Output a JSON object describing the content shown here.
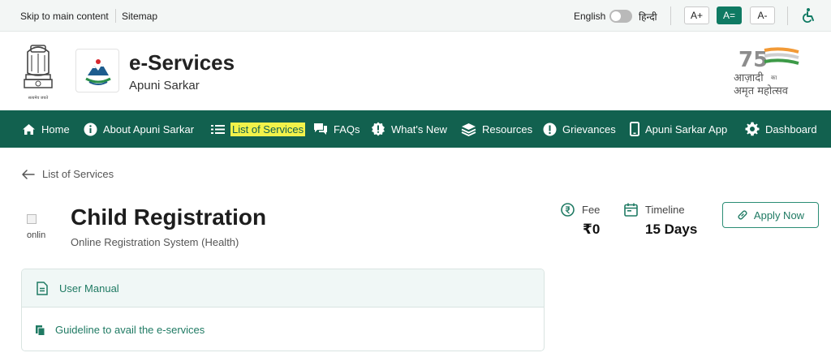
{
  "topbar": {
    "skip_link": "Skip to main content",
    "sitemap_link": "Sitemap",
    "lang_english": "English",
    "lang_hindi": "हिन्दी",
    "font_increase": "A+",
    "font_normal": "A=",
    "font_decrease": "A-"
  },
  "header": {
    "title": "e-Services",
    "subtitle": "Apuni Sarkar",
    "emblem_text": "सत्यमेव जयते",
    "azadi_number": "75",
    "azadi_line1": "आज़ादी",
    "azadi_ka": "का",
    "azadi_line2": "अमृत महोत्सव"
  },
  "nav": {
    "items": [
      {
        "label": "Home",
        "icon": "home-icon"
      },
      {
        "label": "About Apuni Sarkar",
        "icon": "info-icon"
      },
      {
        "label": "List of Services",
        "icon": "list-icon"
      },
      {
        "label": "FAQs",
        "icon": "chat-icon"
      },
      {
        "label": "What's New",
        "icon": "badge-alert-icon"
      },
      {
        "label": "Resources",
        "icon": "layers-icon"
      },
      {
        "label": "Grievances",
        "icon": "alert-circle-icon"
      },
      {
        "label": "Apuni Sarkar App",
        "icon": "mobile-icon"
      },
      {
        "label": "Dashboard",
        "icon": "gear-icon"
      }
    ]
  },
  "breadcrumb": {
    "back_label": "List of Services"
  },
  "service": {
    "image_alt": "onlin",
    "title": "Child Registration",
    "subtitle": "Online Registration System (Health)",
    "fee_label": "Fee",
    "fee_value": "₹0",
    "timeline_label": "Timeline",
    "timeline_value": "15 Days",
    "apply_label": "Apply Now"
  },
  "documents": {
    "user_manual": "User Manual",
    "guideline": "Guideline to avail the e-services"
  },
  "colors": {
    "brand_green": "#12614f",
    "accent_teal": "#0f7a63",
    "highlight": "#f2f24a"
  }
}
